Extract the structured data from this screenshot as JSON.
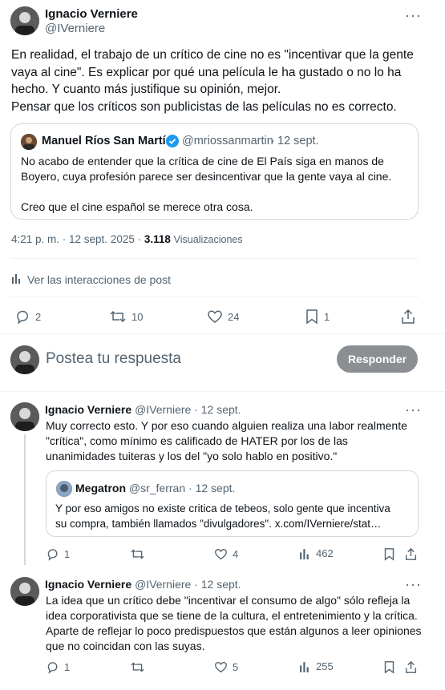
{
  "main_tweet": {
    "author_name": "Ignacio Verniere",
    "author_handle": "@IVerniere",
    "text": "En realidad, el trabajo de un crítico de cine no es \"incentivar que la gente vaya al cine\". Es explicar por qué una película le ha gustado o no lo ha hecho. Y cuanto más justifique su opinión, mejor.\nPensar que los críticos son publicistas de las películas no es correcto.",
    "quote": {
      "author_name": "Manuel Ríos San Martín",
      "author_handle": "@mriossanmartin",
      "separator": "·",
      "date": "12 sept.",
      "text": "No acabo de entender que la crítica de cine de El País siga en manos de Boyero, cuya profesión parece ser desincentivar que la gente vaya al cine.\n\nCreo que el cine español se merece otra cosa."
    },
    "timestamp": "4:21 p. m. · 12 sept. 2025 ·",
    "views_count": "3.118",
    "views_label": "Visualizaciones",
    "interactions_link": "Ver las interacciones de post",
    "stats": {
      "replies": "2",
      "reposts": "10",
      "likes": "24",
      "bookmarks": "1"
    }
  },
  "composer": {
    "placeholder": "Postea tu respuesta",
    "reply_button": "Responder"
  },
  "replies": [
    {
      "author_name": "Ignacio Verniere",
      "author_handle": "@IVerniere",
      "date": "· 12 sept.",
      "text": "Muy correcto esto. Y por eso cuando alguien realiza una labor realmente \"crítica\", como mínimo es calificado de HATER por los de las unanimidades tuiteras y los del \"yo solo hablo en positivo.\"",
      "quote": {
        "author_name": "Megatron",
        "author_handle": "@sr_ferran",
        "date": "· 12 sept.",
        "text": "Y por eso amigos no existe critica de tebeos, solo gente que incentiva\nsu compra, también llamados \"divulgadores\". x.com/IVerniere/stat…"
      },
      "stats": {
        "replies": "1",
        "reposts": "",
        "likes": "4",
        "views": "462"
      }
    },
    {
      "author_name": "Ignacio Verniere",
      "author_handle": "@IVerniere",
      "date": "· 12 sept.",
      "text": "La idea que un crítico debe \"incentivar el consumo de algo\" sólo refleja la idea corporativista que se tiene de la cultura, el entretenimiento y la crítica. Aparte de reflejar lo poco predispuestos que están algunos a leer opiniones que no coincidan con las suyas.",
      "stats": {
        "replies": "1",
        "reposts": "",
        "likes": "5",
        "views": "255"
      }
    }
  ],
  "colors": {
    "accent": "#1d9bf0",
    "muted": "#536471",
    "text": "#0f1419",
    "border": "#cfd9de",
    "reply_button_bg": "#8b8f93"
  },
  "icons": [
    "more-icon",
    "verified-icon",
    "reply-icon",
    "repost-icon",
    "like-icon",
    "bookmark-icon",
    "share-icon",
    "views-icon",
    "analytics-icon"
  ]
}
